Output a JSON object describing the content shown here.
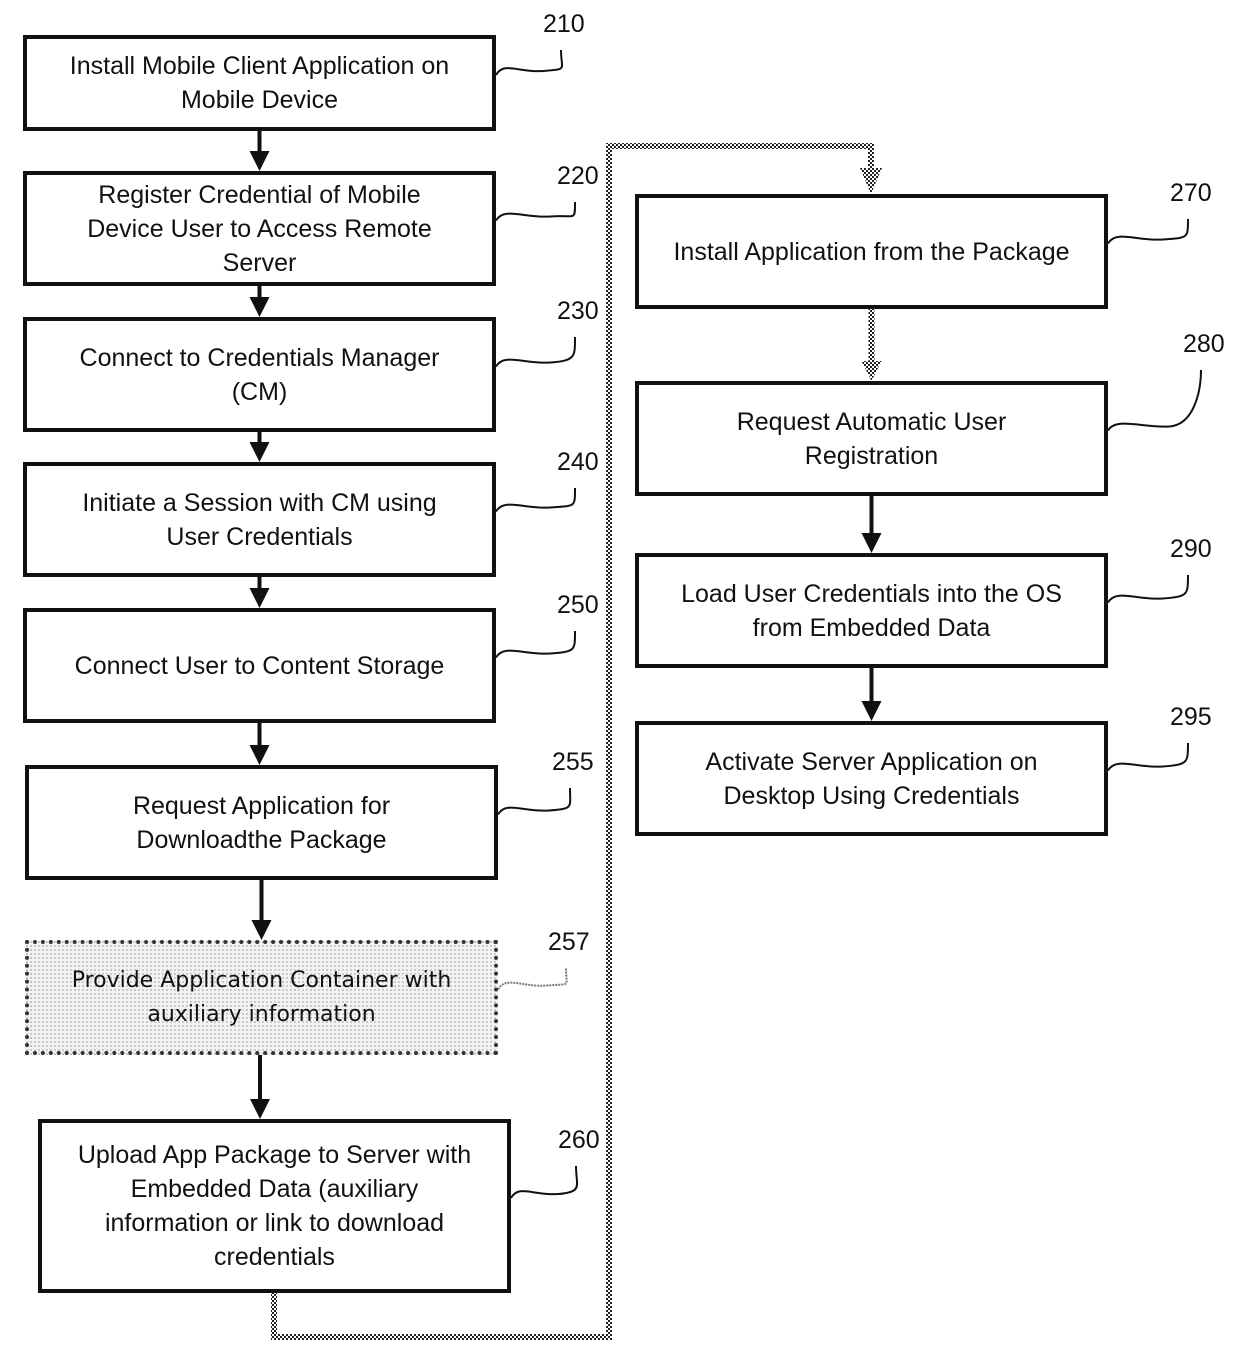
{
  "diagram": {
    "type": "flowchart",
    "steps": [
      {
        "id": "210",
        "ref": "210",
        "label": "Install Mobile Client Application on\nMobile Device",
        "style": "solid"
      },
      {
        "id": "220",
        "ref": "220",
        "label": "Register Credential of Mobile\nDevice User to Access Remote\nServer",
        "style": "solid"
      },
      {
        "id": "230",
        "ref": "230",
        "label": "Connect to Credentials Manager\n(CM)",
        "style": "solid"
      },
      {
        "id": "240",
        "ref": "240",
        "label": "Initiate a Session with CM using\nUser Credentials",
        "style": "solid"
      },
      {
        "id": "250",
        "ref": "250",
        "label": "Connect User to Content Storage",
        "style": "solid"
      },
      {
        "id": "255",
        "ref": "255",
        "label": "Request  Application for\nDownloadthe Package",
        "style": "solid"
      },
      {
        "id": "257",
        "ref": "257",
        "label": "Provide  Application Container with\nauxiliary information",
        "style": "dotted"
      },
      {
        "id": "260",
        "ref": "260",
        "label": "Upload App Package to Server with\nEmbedded Data (auxiliary\ninformation or link to download\ncredentials",
        "style": "solid"
      },
      {
        "id": "270",
        "ref": "270",
        "label": "Install Application from the Package",
        "style": "solid"
      },
      {
        "id": "280",
        "ref": "280",
        "label": "Request Automatic User\nRegistration",
        "style": "solid"
      },
      {
        "id": "290",
        "ref": "290",
        "label": "Load User Credentials into the OS\nfrom Embedded Data",
        "style": "solid"
      },
      {
        "id": "295",
        "ref": "295",
        "label": "Activate Server Application on\nDesktop Using Credentials",
        "style": "solid"
      }
    ],
    "edges": [
      {
        "from": "210",
        "to": "220",
        "style": "solid"
      },
      {
        "from": "220",
        "to": "230",
        "style": "solid"
      },
      {
        "from": "230",
        "to": "240",
        "style": "solid"
      },
      {
        "from": "240",
        "to": "250",
        "style": "solid"
      },
      {
        "from": "250",
        "to": "255",
        "style": "solid"
      },
      {
        "from": "255",
        "to": "257",
        "style": "solid"
      },
      {
        "from": "257",
        "to": "260",
        "style": "solid"
      },
      {
        "from": "260",
        "to": "270",
        "style": "dotted"
      },
      {
        "from": "270",
        "to": "280",
        "style": "dotted"
      },
      {
        "from": "280",
        "to": "290",
        "style": "solid"
      },
      {
        "from": "290",
        "to": "295",
        "style": "solid"
      }
    ]
  }
}
